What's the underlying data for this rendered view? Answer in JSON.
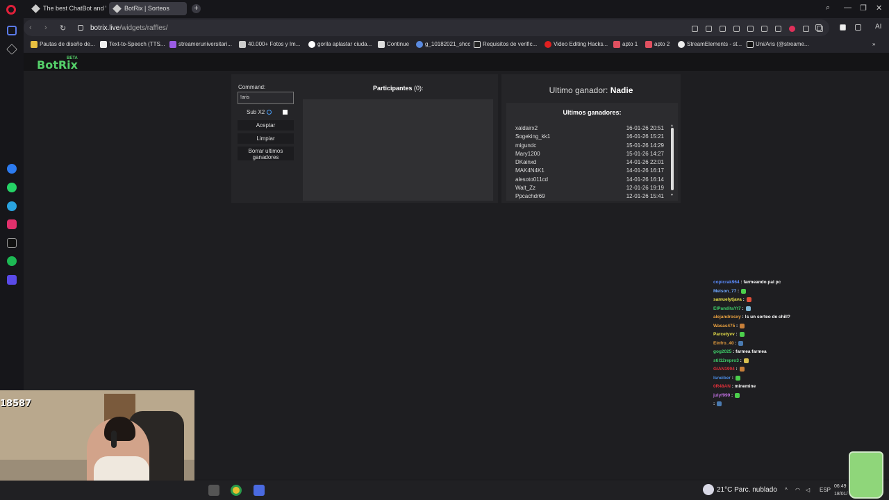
{
  "browser": {
    "tabs": [
      {
        "label": "The best ChatBot and Wid"
      },
      {
        "label": "BotRix | Sorteos"
      }
    ],
    "new_tab_label": "+",
    "url_host": "botrix.live",
    "url_path": "/widgets/raffles/",
    "ai_label": "AI",
    "bookmarks": [
      "Pautas de diseño de...",
      "Text-to-Speech (TTS...",
      "streameruniversitari...",
      "40.000+ Fotos y Im...",
      "gorila aplastar ciuda...",
      "Continue",
      "g_10182021_shcc",
      "Requisitos de verific...",
      "Video Editing Hacks...",
      "apto 1",
      "apto 2",
      "StreamElements - st...",
      "Uni/Aris (@streame..."
    ]
  },
  "app": {
    "logo": "BotRix",
    "beta": "BETA"
  },
  "raffle": {
    "command_label": "Command:",
    "command_value": "!aris",
    "sub_label": "Sub X2",
    "accept_button": "Aceptar",
    "clear_button": "Limpiar",
    "delete_button_line1": "Borrar ultimos",
    "delete_button_line2": "ganadores",
    "participants_label": "Participantes",
    "participants_count": "(0):",
    "last_winner_label": "Ultimo ganador:",
    "last_winner_value": "Nadie",
    "winners_title": "Ultimos ganadores:",
    "winners": [
      {
        "name": "xaldairx2",
        "date": "16-01-26 20:51"
      },
      {
        "name": "Sogeking_kk1",
        "date": "16-01-26 15:21"
      },
      {
        "name": "migundc",
        "date": "15-01-26 14:29"
      },
      {
        "name": "Mary1200",
        "date": "15-01-26 14:27"
      },
      {
        "name": "DKainxd",
        "date": "14-01-26 22:01"
      },
      {
        "name": "MAK4N4K1",
        "date": "14-01-26 16:17"
      },
      {
        "name": "alesoto011cd",
        "date": "14-01-26 16:14"
      },
      {
        "name": "Walt_Zz",
        "date": "12-01-26 19:19"
      },
      {
        "name": "Ppcachdr69",
        "date": "12-01-26 15:41"
      }
    ]
  },
  "chat": [
    {
      "user": "copicrak964",
      "color": "#5b8cff",
      "msg": ": farmeando pal pc",
      "emote": ""
    },
    {
      "user": "Meison_77",
      "color": "#6fa8ff",
      "msg": ":",
      "emote": "#4ccf4c"
    },
    {
      "user": "samuelytjava",
      "color": "#e8e04a",
      "msg": ":",
      "emote": "#e0503a"
    },
    {
      "user": "ElPanditaYt7",
      "color": "#3fd06a",
      "msg": ":",
      "emote": "#7fb8d8"
    },
    {
      "user": "alejandrosxy",
      "color": "#e8a040",
      "msg": ": !s un sorteo de chill?",
      "emote": ""
    },
    {
      "user": "Wasas475",
      "color": "#e8a040",
      "msg": ":",
      "emote": "#c8803a"
    },
    {
      "user": "Parcetyvv",
      "color": "#e8e04a",
      "msg": ":",
      "emote": "#4ccf4c"
    },
    {
      "user": "Einfro_40",
      "color": "#e8a040",
      "msg": ":",
      "emote": "#4a7ab0"
    },
    {
      "user": "gog2025",
      "color": "#3fd06a",
      "msg": ": farmea farmea",
      "emote": ""
    },
    {
      "user": "stil12repro3",
      "color": "#3fd06a",
      "msg": ":",
      "emote": "#d8c050"
    },
    {
      "user": "GIAN1994",
      "color": "#e0303a",
      "msg": ":",
      "emote": "#c8803a"
    },
    {
      "user": "Isneiber",
      "color": "#4a8ae0",
      "msg": ":",
      "emote": "#4ccf4c"
    },
    {
      "user": "0R48AN",
      "color": "#e0303a",
      "msg": ": minemine",
      "emote": ""
    },
    {
      "user": "julyf999",
      "color": "#c070e0",
      "msg": ":",
      "emote": "#4ccf4c"
    },
    {
      "user": "",
      "color": "#ffffff",
      "msg": ":",
      "emote": "#4a7ab0"
    }
  ],
  "stream": {
    "counter": "18587"
  },
  "taskbar": {
    "weather": "21°C  Parc. nublado",
    "lang": "ESP",
    "time": "06:49",
    "date": "18/01/"
  }
}
